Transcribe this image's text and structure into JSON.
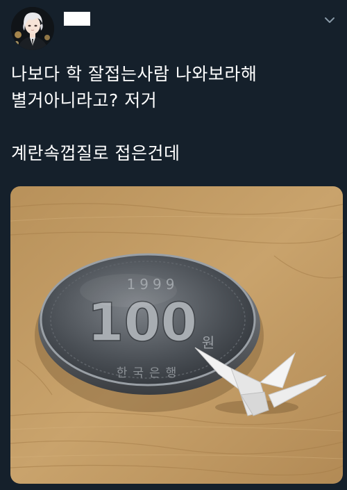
{
  "tweet": {
    "author_name": "",
    "lines": [
      "나보다 학 잘접는사람 나와보라해",
      "별거아니라고? 저거",
      "계란속껍질로 접은건데"
    ]
  },
  "photo": {
    "coin_year": "1999",
    "coin_value": "100",
    "coin_unit": "원",
    "coin_country": "한국은행"
  },
  "colors": {
    "background": "#15202b",
    "text": "#ffffff",
    "muted": "#8899a6"
  },
  "icons": {
    "menu": "chevron-down-icon"
  }
}
